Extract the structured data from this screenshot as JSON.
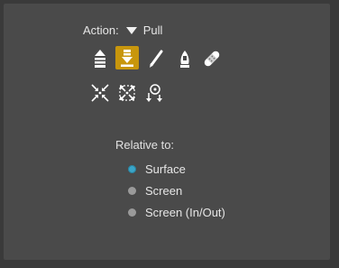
{
  "action": {
    "label": "Action:",
    "value": "Pull"
  },
  "tools": [
    {
      "icon": "push-icon"
    },
    {
      "icon": "pull-icon",
      "active": true
    },
    {
      "icon": "pen-icon"
    },
    {
      "icon": "smooth-icon"
    },
    {
      "icon": "bandage-icon"
    },
    {
      "icon": "pinch-icon"
    },
    {
      "icon": "expand-icon"
    },
    {
      "icon": "relax-icon"
    }
  ],
  "relative_to": {
    "label": "Relative to:",
    "options": [
      {
        "label": "Surface",
        "selected": true
      },
      {
        "label": "Screen",
        "selected": false
      },
      {
        "label": "Screen (In/Out)",
        "selected": false
      }
    ]
  },
  "colors": {
    "background": "#3a3a3a",
    "panel": "#4a4a4a",
    "active_tool": "#c8960c",
    "radio_selected": "#3aa5c8",
    "radio_unselected": "#9a9a9a"
  }
}
